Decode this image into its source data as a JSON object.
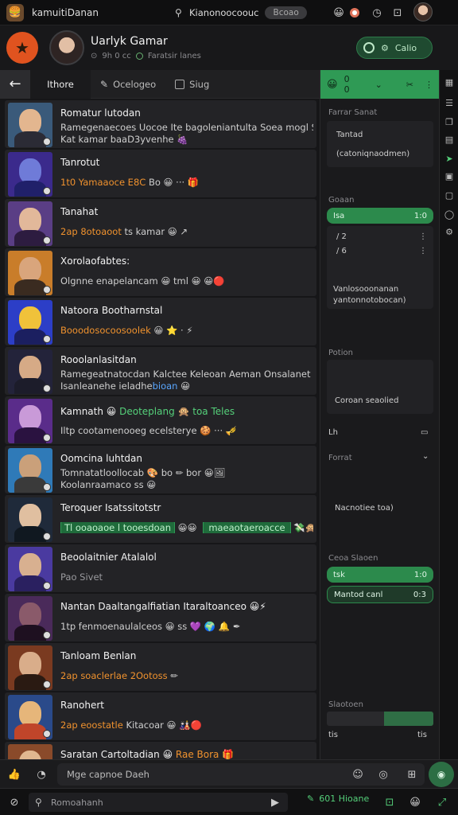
{
  "topbar": {
    "app_title": "kamuitiDanan",
    "search_text": "Kianonoocoouc",
    "search_pill": "Bcoao",
    "icons": [
      "bell-emoji-icon",
      "record-icon",
      "clock-icon",
      "stop-icon"
    ]
  },
  "profile": {
    "name": "Uarlyk Gamar",
    "sub_left": "9h 0 cc",
    "sub_right": "Faratsir lanes",
    "follow_label": "Calio"
  },
  "tabs": [
    {
      "label": "Ithore"
    },
    {
      "label": "Ocelogeo"
    },
    {
      "label": "Siug"
    }
  ],
  "chats": [
    {
      "title": "Romatur lutodan",
      "line1": "Ramegenaecoes Uocoe Ite bagoleniantulta Soea mogl Sacas",
      "line2": "Kat kamar baaD3yvenhe 🍇",
      "colors": [
        "#3a5a7a",
        "#e3b68f",
        "#2b2b35"
      ]
    },
    {
      "title": "Tanrotut",
      "line1_orange": "1t0 Yamaaoce E8C",
      "line1_rest": " Bo 😀 ··· 🎁",
      "colors": [
        "#3b2a8c",
        "#6f7bd8",
        "#20206a"
      ]
    },
    {
      "title": "Tanahat",
      "line1_orange": "2ap 8otoaoot",
      "line1_rest": " ts kamar 😀 ↗",
      "colors": [
        "#5a3e85",
        "#e2b89a",
        "#2d1c40"
      ]
    },
    {
      "title": "Xorolaofabtes:",
      "line1": "Olgnne enapelancam 😀 tml 😀  😀🔴",
      "colors": [
        "#c97d2a",
        "#d9a57c",
        "#3a2b20"
      ]
    },
    {
      "title": "Natoora Bootharnstal",
      "line1_orange": "Booodosocoosoolek",
      "line1_rest": " 😀 ⭐ · ⚡",
      "colors": [
        "#2c3ec7",
        "#f0c23a",
        "#1b1f60"
      ]
    },
    {
      "title": "Rooolanlasitdan",
      "line1": "Ramegeatnatocdan Kalctee Keleoan Aeman Onsalanet Mcale",
      "line2_pre": "Isanleanehe ieladhe",
      "line2_blue": "bioan",
      "line2_post": " 😀",
      "colors": [
        "#23233a",
        "#d6aa86",
        "#1c1c2a"
      ]
    },
    {
      "title": "Kamnath",
      "line1_pre": "Kamnath 😀 ",
      "line1_green": "Deoteplang 🙊 toa Teles",
      "line2": "Iltp cootamenooeg ecelsterye 🍪 ··· 🎺",
      "colors": [
        "#5a2c8a",
        "#c99ad8",
        "#2a1240"
      ]
    },
    {
      "title": "Oomcina luhtdan",
      "line1": "Tomnatatloollocab 🎨 bo ✏ bor 😀🖼",
      "line2": "Koolanraamaco ss 😀",
      "colors": [
        "#2f7ab8",
        "#caa07a",
        "#3a3a3a"
      ]
    },
    {
      "title": "Teroquer Isatssitotstr",
      "line1_pill": "Tl ooaoaoe l tooesdoan",
      "line1_mid": " 😀😀 ",
      "line1_pill2": "maeaotaeroacce",
      "line1_end": " 💸🙊",
      "colors": [
        "#1f2a3a",
        "#e0bfa0",
        "#101820"
      ]
    },
    {
      "title": "Beoolaitnier Atalalol",
      "line1": "Pao Sivet",
      "colors": [
        "#4a3aa0",
        "#d8b090",
        "#2a2060"
      ]
    },
    {
      "title": "Nantan Daaltangalfiatian Itaraltoanceo 😀⚡",
      "line1": "1tp fenmoenaulalceos 😀 ss 💜 🌍 🔔 ✒",
      "colors": [
        "#4a2a5a",
        "#8a5a6a",
        "#1e1020"
      ]
    },
    {
      "title": "Tanloam Benlan",
      "line1_orange": "2ap soaclerlae 2Ootoss",
      "line1_rest": " ✏",
      "colors": [
        "#7a3a20",
        "#d9ad8a",
        "#2a1a12"
      ]
    },
    {
      "title": "Ranohert",
      "line1_orange": "2ap eoostatle",
      "line1_rest": " Kitacoar 😀 🎎🔴",
      "colors": [
        "#2a4a8a",
        "#e6b67a",
        "#c0452a"
      ]
    },
    {
      "title": "Saratan Cartoltadian 😀 ",
      "title_orange": "Rae Bora",
      "title_end": " 🎁",
      "colors": [
        "#8a4a2a",
        "#e0b890",
        "#2a1a12"
      ]
    }
  ],
  "right_panel": {
    "head_emoji": "😀",
    "head_value": "0 0",
    "sec1_label": "Farrar Sanat",
    "sec1_item_green": "Tantad",
    "sec1_item": "(catoniqnaodmen)",
    "sec2_label": "Goaan",
    "sec2_pill_left": "Isa",
    "sec2_pill_right": "1:0",
    "sec2_r1": "/ 2",
    "sec2_r2": "/ 6",
    "sec2_text1": "Vanlosooonanan",
    "sec2_text2": "yantonnotobocan)",
    "sec3_label": "Potion",
    "sec3_text": "Coroan seaolied",
    "sec3_left": "Lh",
    "sec4_label": "Forrat",
    "sec4_text": "Nacnotiee toa)",
    "sec5_label": "Ceoa Slaoen",
    "sec5_pill_left": "tsk",
    "sec5_pill_right": "1:0",
    "sec5_pill2_left": "Mantod canl",
    "sec5_pill2_right": "0:3",
    "sec6_label": "Slaotoen",
    "sec6_left": "tis",
    "sec6_right": "tis"
  },
  "composer": {
    "placeholder": "Mge capnoe Daeh"
  },
  "bottombar": {
    "search": "Romoahanh",
    "status_label": "601 Hioane"
  }
}
